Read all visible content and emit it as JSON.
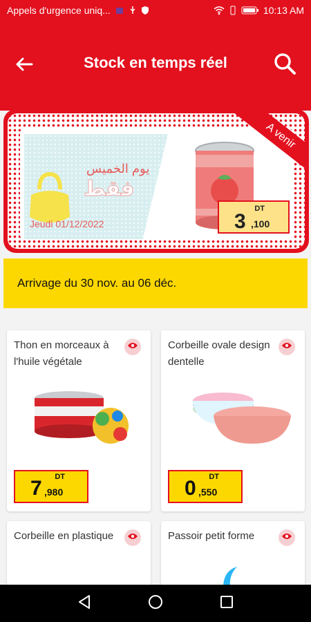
{
  "status_bar": {
    "notification_text": "Appels d'urgence uniq...",
    "time": "10:13 AM",
    "color": "#e3101e"
  },
  "header": {
    "title": "Stock en temps réel",
    "back_icon": "arrow-left-icon",
    "search_icon": "search-icon"
  },
  "banner": {
    "arabic_day": "يوم الخميس",
    "arabic_only": "فقط",
    "date": "Jeudi 01/12/2022",
    "ribbon": "A venir",
    "price_currency": "DT",
    "price_main": "3",
    "price_sub": ",100"
  },
  "notice": {
    "text": "Arrivage du 30 nov. au 06 déc."
  },
  "products": [
    {
      "name": "Thon en morceaux à l'huile végétale",
      "currency": "DT",
      "price_main": "7",
      "price_sub": ",980"
    },
    {
      "name": "Corbeille ovale design dentelle",
      "currency": "DT",
      "price_main": "0",
      "price_sub": ",550"
    },
    {
      "name": "Corbeille en plastique"
    },
    {
      "name": "Passoir petit forme"
    }
  ],
  "colors": {
    "brand_red": "#e3101e",
    "accent_yellow": "#fdd800"
  }
}
